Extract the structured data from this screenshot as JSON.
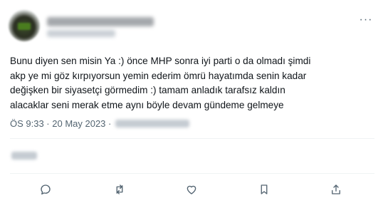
{
  "tweet": {
    "text_lines": [
      "Bunu diyen sen misin Ya :) önce MHP sonra iyi parti o da olmadı şimdi",
      "akp ye mi göz kırpıyorsun yemin ederim ömrü hayatımda senin kadar",
      "değişken bir siyasetçi görmedim :) tamam anladık tarafsız kaldın",
      "alacaklar seni merak etme aynı böyle devam gündeme gelmeye"
    ],
    "timestamp": "ÖS 9:33 · 20 May 2023 ·"
  },
  "actions": {
    "reply_icon": "reply-icon",
    "retweet_icon": "retweet-icon",
    "like_icon": "like-icon",
    "bookmark_icon": "bookmark-icon",
    "share_icon": "share-icon"
  },
  "colors": {
    "text": "#0f1419",
    "secondary": "#536471",
    "divider": "#eff3f4"
  }
}
